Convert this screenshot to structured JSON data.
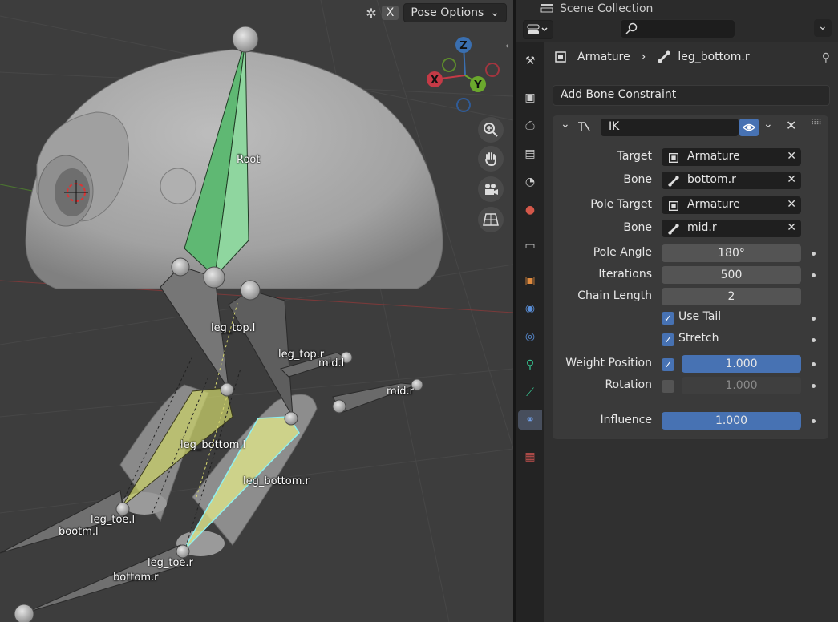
{
  "viewport": {
    "header": {
      "x_chip": "X",
      "pose_options": "Pose Options"
    },
    "gizmo": {
      "z": "Z",
      "y": "Y",
      "x": "X"
    },
    "bone_labels": [
      "Root",
      "leg_top.l",
      "leg_top.r",
      "mid.l",
      "mid.r",
      "leg_bottom.l",
      "leg_bottom.r",
      "leg_toe.l",
      "bootm.l",
      "leg_toe.r",
      "bottom.r"
    ],
    "nav_icons": [
      "zoom-icon",
      "hand-pan-icon",
      "camera-icon",
      "grid-perspective-icon"
    ]
  },
  "properties": {
    "outliner_title": "Scene Collection",
    "breadcrumb": {
      "object": "Armature",
      "bone": "leg_bottom.r"
    },
    "add_constraint_label": "Add Bone Constraint",
    "constraint": {
      "name": "IK",
      "target_label": "Target",
      "target_value": "Armature",
      "bone_label": "Bone",
      "bone_value": "bottom.r",
      "pole_target_label": "Pole Target",
      "pole_target_value": "Armature",
      "pole_bone_label": "Bone",
      "pole_bone_value": "mid.r",
      "pole_angle_label": "Pole Angle",
      "pole_angle_value": "180°",
      "iterations_label": "Iterations",
      "iterations_value": "500",
      "chain_length_label": "Chain Length",
      "chain_length_value": "2",
      "use_tail_label": "Use Tail",
      "stretch_label": "Stretch",
      "weight_position_label": "Weight Position",
      "weight_position_value": "1.000",
      "rotation_label": "Rotation",
      "rotation_value": "1.000",
      "influence_label": "Influence",
      "influence_value": "1.000"
    },
    "tabs": [
      "tool",
      "render",
      "output",
      "view-layer",
      "scene",
      "world",
      "collection",
      "object",
      "modifiers",
      "physics",
      "object-constraints",
      "object-data",
      "bone",
      "bone-constraints",
      "texture"
    ]
  },
  "colors": {
    "accent": "#4772b3",
    "active_bone": "#6fcf8f",
    "selected_bone": "#d8e36a"
  }
}
